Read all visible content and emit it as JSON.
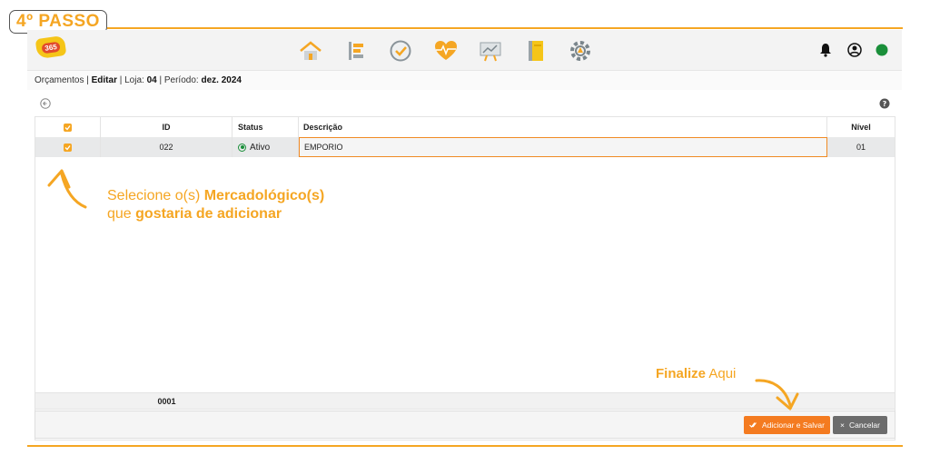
{
  "tutorial": {
    "step_badge": "4º PASSO",
    "instruction_prefix": "Selecione o(s) ",
    "instruction_bold1": "Mercadológico(s)",
    "instruction_mid": "que ",
    "instruction_bold2": "gostaria de adicionar",
    "finalize_bold": "Finalize",
    "finalize_rest": " Aqui",
    "accent_color": "#f5a623"
  },
  "topbar": {
    "logo_text": "365",
    "nav_icons": [
      "home-icon",
      "list-icon",
      "check-circle-icon",
      "heart-pulse-icon",
      "chart-board-icon",
      "notebook-icon",
      "gear-icon"
    ],
    "right_icons": [
      "bell-icon",
      "user-circle-icon",
      "status-dot-icon"
    ],
    "status_color": "#1a8f3a"
  },
  "breadcrumb": {
    "section": "Orçamentos",
    "sep1": " | ",
    "action": "Editar",
    "sep2": " | Loja: ",
    "loja": "04",
    "sep3": " | Período: ",
    "periodo": "dez. 2024"
  },
  "grid": {
    "columns": [
      "ID",
      "Status",
      "Descrição",
      "Nível"
    ],
    "rows": [
      {
        "id": "022",
        "status": "Ativo",
        "descricao": "EMPORIO",
        "nivel": "01",
        "selected": true
      }
    ],
    "footer_total": "0001"
  },
  "actions": {
    "save_label": "Adicionar e Salvar",
    "cancel_label": "Cancelar",
    "save_color": "#f47b20",
    "cancel_color": "#6c6c6c"
  }
}
